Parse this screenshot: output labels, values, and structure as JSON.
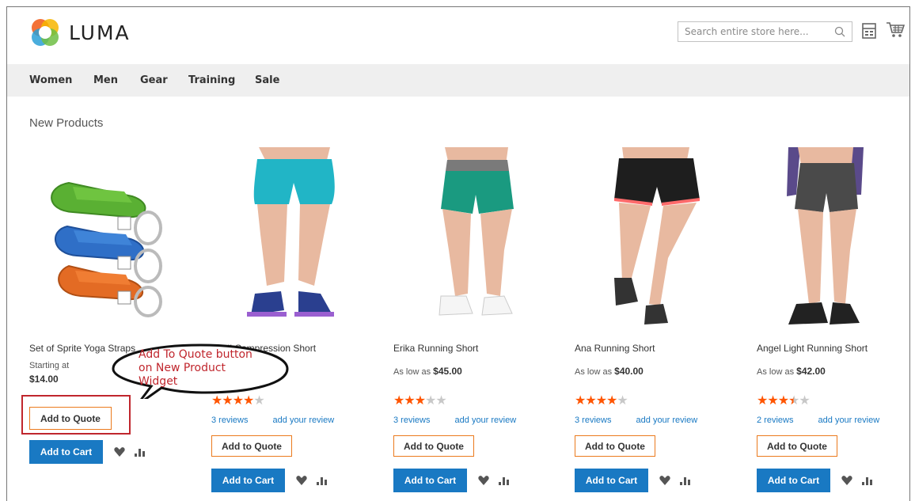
{
  "header": {
    "logo_text": "LUMA",
    "search_placeholder": "Search entire store here...",
    "icons": [
      "search-icon",
      "compare-icon",
      "cart-icon"
    ]
  },
  "nav": {
    "items": [
      {
        "label": "Women"
      },
      {
        "label": "Men"
      },
      {
        "label": "Gear"
      },
      {
        "label": "Training"
      },
      {
        "label": "Sale"
      }
    ]
  },
  "section_title": "New Products",
  "products": [
    {
      "name": "Set of Sprite Yoga Straps",
      "price_prefix": "Starting at",
      "price": "$14.00",
      "rating": null,
      "reviews": null,
      "add_review": null,
      "quote_label": "Add to Quote",
      "cart_label": "Add to Cart"
    },
    {
      "name": "Sybil Compression Short",
      "price_prefix": "",
      "price": "",
      "rating": 4,
      "reviews": "3  reviews",
      "add_review": "add your review",
      "quote_label": "Add to Quote",
      "cart_label": "Add to Cart"
    },
    {
      "name": "Erika Running Short",
      "price_prefix": "As low as",
      "price": "$45.00",
      "rating": 3,
      "reviews": "3  reviews",
      "add_review": "add your review",
      "quote_label": "Add to Quote",
      "cart_label": "Add to Cart"
    },
    {
      "name": "Ana Running Short",
      "price_prefix": "As low as",
      "price": "$40.00",
      "rating": 4,
      "reviews": "3  reviews",
      "add_review": "add your review",
      "quote_label": "Add to Quote",
      "cart_label": "Add to Cart"
    },
    {
      "name": "Angel Light Running Short",
      "price_prefix": "As low as",
      "price": "$42.00",
      "rating": 3.5,
      "reviews": "2  reviews",
      "add_review": "add your review",
      "quote_label": "Add to Quote",
      "cart_label": "Add to Cart"
    }
  ],
  "annotation": {
    "line1": "Add To Quote button",
    "line2": "on New Product",
    "line3": "Widget"
  },
  "colors": {
    "accent_blue": "#1979c3",
    "quote_border": "#eb7a1d",
    "star": "#ff5501",
    "annotation_red": "#c0262d"
  }
}
